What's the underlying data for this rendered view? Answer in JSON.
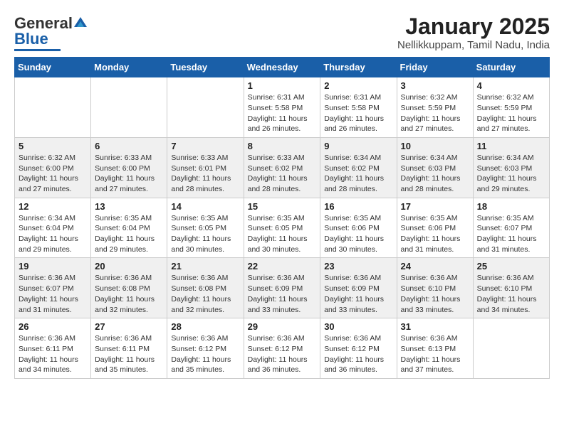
{
  "header": {
    "logo_general": "General",
    "logo_blue": "Blue",
    "month": "January 2025",
    "location": "Nellikkuppam, Tamil Nadu, India"
  },
  "weekdays": [
    "Sunday",
    "Monday",
    "Tuesday",
    "Wednesday",
    "Thursday",
    "Friday",
    "Saturday"
  ],
  "weeks": [
    [
      {
        "day": "",
        "sunrise": "",
        "sunset": "",
        "daylight": ""
      },
      {
        "day": "",
        "sunrise": "",
        "sunset": "",
        "daylight": ""
      },
      {
        "day": "",
        "sunrise": "",
        "sunset": "",
        "daylight": ""
      },
      {
        "day": "1",
        "sunrise": "Sunrise: 6:31 AM",
        "sunset": "Sunset: 5:58 PM",
        "daylight": "Daylight: 11 hours and 26 minutes."
      },
      {
        "day": "2",
        "sunrise": "Sunrise: 6:31 AM",
        "sunset": "Sunset: 5:58 PM",
        "daylight": "Daylight: 11 hours and 26 minutes."
      },
      {
        "day": "3",
        "sunrise": "Sunrise: 6:32 AM",
        "sunset": "Sunset: 5:59 PM",
        "daylight": "Daylight: 11 hours and 27 minutes."
      },
      {
        "day": "4",
        "sunrise": "Sunrise: 6:32 AM",
        "sunset": "Sunset: 5:59 PM",
        "daylight": "Daylight: 11 hours and 27 minutes."
      }
    ],
    [
      {
        "day": "5",
        "sunrise": "Sunrise: 6:32 AM",
        "sunset": "Sunset: 6:00 PM",
        "daylight": "Daylight: 11 hours and 27 minutes."
      },
      {
        "day": "6",
        "sunrise": "Sunrise: 6:33 AM",
        "sunset": "Sunset: 6:00 PM",
        "daylight": "Daylight: 11 hours and 27 minutes."
      },
      {
        "day": "7",
        "sunrise": "Sunrise: 6:33 AM",
        "sunset": "Sunset: 6:01 PM",
        "daylight": "Daylight: 11 hours and 28 minutes."
      },
      {
        "day": "8",
        "sunrise": "Sunrise: 6:33 AM",
        "sunset": "Sunset: 6:02 PM",
        "daylight": "Daylight: 11 hours and 28 minutes."
      },
      {
        "day": "9",
        "sunrise": "Sunrise: 6:34 AM",
        "sunset": "Sunset: 6:02 PM",
        "daylight": "Daylight: 11 hours and 28 minutes."
      },
      {
        "day": "10",
        "sunrise": "Sunrise: 6:34 AM",
        "sunset": "Sunset: 6:03 PM",
        "daylight": "Daylight: 11 hours and 28 minutes."
      },
      {
        "day": "11",
        "sunrise": "Sunrise: 6:34 AM",
        "sunset": "Sunset: 6:03 PM",
        "daylight": "Daylight: 11 hours and 29 minutes."
      }
    ],
    [
      {
        "day": "12",
        "sunrise": "Sunrise: 6:34 AM",
        "sunset": "Sunset: 6:04 PM",
        "daylight": "Daylight: 11 hours and 29 minutes."
      },
      {
        "day": "13",
        "sunrise": "Sunrise: 6:35 AM",
        "sunset": "Sunset: 6:04 PM",
        "daylight": "Daylight: 11 hours and 29 minutes."
      },
      {
        "day": "14",
        "sunrise": "Sunrise: 6:35 AM",
        "sunset": "Sunset: 6:05 PM",
        "daylight": "Daylight: 11 hours and 30 minutes."
      },
      {
        "day": "15",
        "sunrise": "Sunrise: 6:35 AM",
        "sunset": "Sunset: 6:05 PM",
        "daylight": "Daylight: 11 hours and 30 minutes."
      },
      {
        "day": "16",
        "sunrise": "Sunrise: 6:35 AM",
        "sunset": "Sunset: 6:06 PM",
        "daylight": "Daylight: 11 hours and 30 minutes."
      },
      {
        "day": "17",
        "sunrise": "Sunrise: 6:35 AM",
        "sunset": "Sunset: 6:06 PM",
        "daylight": "Daylight: 11 hours and 31 minutes."
      },
      {
        "day": "18",
        "sunrise": "Sunrise: 6:35 AM",
        "sunset": "Sunset: 6:07 PM",
        "daylight": "Daylight: 11 hours and 31 minutes."
      }
    ],
    [
      {
        "day": "19",
        "sunrise": "Sunrise: 6:36 AM",
        "sunset": "Sunset: 6:07 PM",
        "daylight": "Daylight: 11 hours and 31 minutes."
      },
      {
        "day": "20",
        "sunrise": "Sunrise: 6:36 AM",
        "sunset": "Sunset: 6:08 PM",
        "daylight": "Daylight: 11 hours and 32 minutes."
      },
      {
        "day": "21",
        "sunrise": "Sunrise: 6:36 AM",
        "sunset": "Sunset: 6:08 PM",
        "daylight": "Daylight: 11 hours and 32 minutes."
      },
      {
        "day": "22",
        "sunrise": "Sunrise: 6:36 AM",
        "sunset": "Sunset: 6:09 PM",
        "daylight": "Daylight: 11 hours and 33 minutes."
      },
      {
        "day": "23",
        "sunrise": "Sunrise: 6:36 AM",
        "sunset": "Sunset: 6:09 PM",
        "daylight": "Daylight: 11 hours and 33 minutes."
      },
      {
        "day": "24",
        "sunrise": "Sunrise: 6:36 AM",
        "sunset": "Sunset: 6:10 PM",
        "daylight": "Daylight: 11 hours and 33 minutes."
      },
      {
        "day": "25",
        "sunrise": "Sunrise: 6:36 AM",
        "sunset": "Sunset: 6:10 PM",
        "daylight": "Daylight: 11 hours and 34 minutes."
      }
    ],
    [
      {
        "day": "26",
        "sunrise": "Sunrise: 6:36 AM",
        "sunset": "Sunset: 6:11 PM",
        "daylight": "Daylight: 11 hours and 34 minutes."
      },
      {
        "day": "27",
        "sunrise": "Sunrise: 6:36 AM",
        "sunset": "Sunset: 6:11 PM",
        "daylight": "Daylight: 11 hours and 35 minutes."
      },
      {
        "day": "28",
        "sunrise": "Sunrise: 6:36 AM",
        "sunset": "Sunset: 6:12 PM",
        "daylight": "Daylight: 11 hours and 35 minutes."
      },
      {
        "day": "29",
        "sunrise": "Sunrise: 6:36 AM",
        "sunset": "Sunset: 6:12 PM",
        "daylight": "Daylight: 11 hours and 36 minutes."
      },
      {
        "day": "30",
        "sunrise": "Sunrise: 6:36 AM",
        "sunset": "Sunset: 6:12 PM",
        "daylight": "Daylight: 11 hours and 36 minutes."
      },
      {
        "day": "31",
        "sunrise": "Sunrise: 6:36 AM",
        "sunset": "Sunset: 6:13 PM",
        "daylight": "Daylight: 11 hours and 37 minutes."
      },
      {
        "day": "",
        "sunrise": "",
        "sunset": "",
        "daylight": ""
      }
    ]
  ]
}
